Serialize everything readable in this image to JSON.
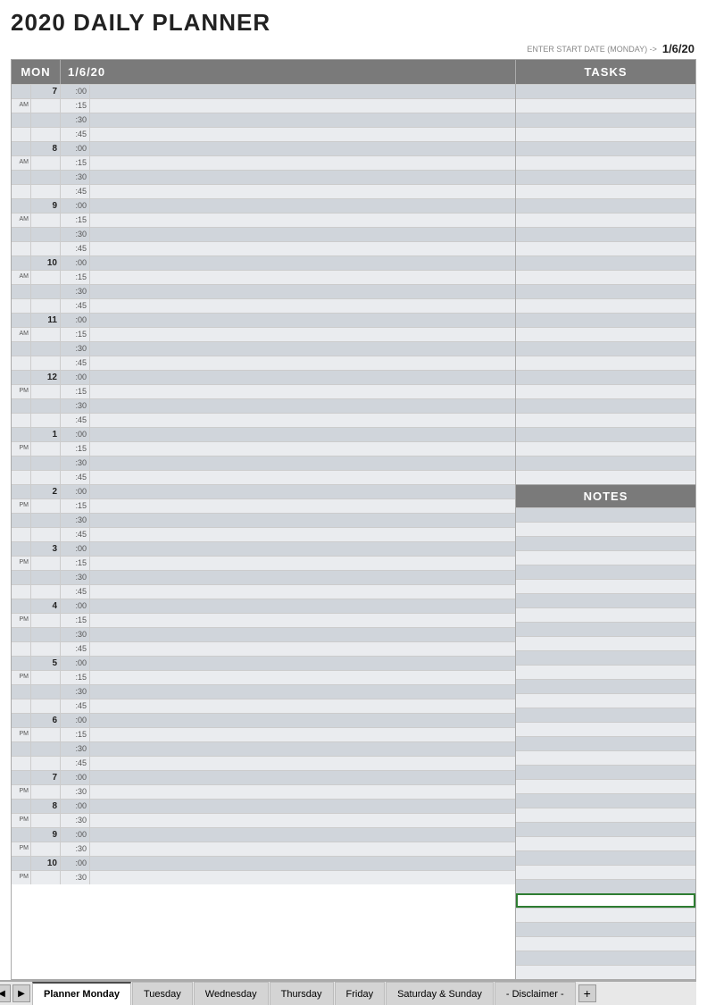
{
  "title": "2020 DAILY PLANNER",
  "start_date_label": "ENTER START DATE (MONDAY) ->",
  "start_date_value": "1/6/20",
  "header": {
    "day": "MON",
    "date": "1/6/20",
    "tasks": "TASKS",
    "notes": "NOTES"
  },
  "time_slots": [
    {
      "hour": "7",
      "ampm": "",
      "slots": [
        ":00",
        ":15",
        ":30",
        ":45"
      ]
    },
    {
      "hour": "8",
      "ampm": "AM",
      "slots": [
        ":00",
        ":15",
        ":30",
        ":45"
      ]
    },
    {
      "hour": "9",
      "ampm": "AM",
      "slots": [
        ":00",
        ":15",
        ":30",
        ":45"
      ]
    },
    {
      "hour": "10",
      "ampm": "AM",
      "slots": [
        ":00",
        ":15",
        ":30",
        ":45"
      ]
    },
    {
      "hour": "11",
      "ampm": "AM",
      "slots": [
        ":00",
        ":15",
        ":30",
        ":45"
      ]
    },
    {
      "hour": "12",
      "ampm": "PM",
      "slots": [
        ":00",
        ":15",
        ":30",
        ":45"
      ]
    },
    {
      "hour": "1",
      "ampm": "PM",
      "slots": [
        ":00",
        ":15",
        ":30",
        ":45"
      ]
    },
    {
      "hour": "2",
      "ampm": "PM",
      "slots": [
        ":00",
        ":15",
        ":30",
        ":45"
      ]
    },
    {
      "hour": "3",
      "ampm": "PM",
      "slots": [
        ":00",
        ":15",
        ":30",
        ":45"
      ]
    },
    {
      "hour": "4",
      "ampm": "PM",
      "slots": [
        ":00",
        ":15",
        ":30",
        ":45"
      ]
    },
    {
      "hour": "5",
      "ampm": "PM",
      "slots": [
        ":00",
        ":15",
        ":30",
        ":45"
      ]
    },
    {
      "hour": "6",
      "ampm": "PM",
      "slots": [
        ":00",
        ":15",
        ":30",
        ":45"
      ]
    },
    {
      "hour": "7",
      "ampm": "PM",
      "slots": [
        ":00",
        ":30"
      ]
    },
    {
      "hour": "8",
      "ampm": "PM",
      "slots": [
        ":00",
        ":30"
      ]
    },
    {
      "hour": "9",
      "ampm": "PM",
      "slots": [
        ":00",
        ":30"
      ]
    },
    {
      "hour": "10",
      "ampm": "PM",
      "slots": [
        ":00",
        ":30"
      ]
    }
  ],
  "tabs": [
    {
      "label": "Planner Monday",
      "active": true
    },
    {
      "label": "Tuesday",
      "active": false
    },
    {
      "label": "Wednesday",
      "active": false
    },
    {
      "label": "Thursday",
      "active": false
    },
    {
      "label": "Friday",
      "active": false
    },
    {
      "label": "Saturday & Sunday",
      "active": false
    },
    {
      "label": "- Disclaimer -",
      "active": false
    }
  ],
  "tab_add_label": "+"
}
